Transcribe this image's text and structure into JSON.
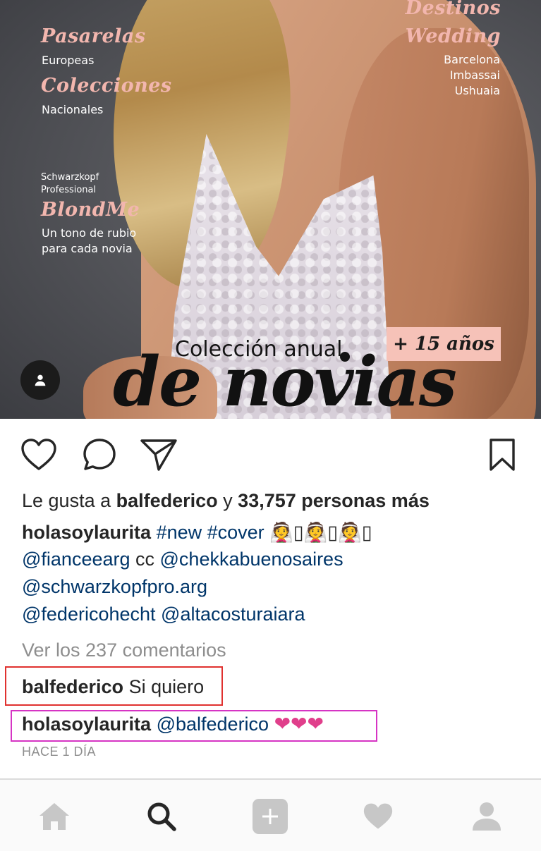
{
  "cover": {
    "pasarelas": "Pasarelas",
    "europeas": "Europeas",
    "colecciones": "Colecciones",
    "nacionales": "Nacionales",
    "schwarzkopf_line1": "Schwarzkopf",
    "schwarzkopf_line2": "Professional",
    "blondme": "BlondMe",
    "blondme_line1": "Un tono de rubio",
    "blondme_line2": "para cada novia",
    "destinos": "Destinos",
    "wedding": "Wedding",
    "cities": [
      "Barcelona",
      "Imbassai",
      "Ushuaia"
    ],
    "badge": "+ 15 años",
    "coleccion_anual": "Colección anual",
    "de_novias": "de novias"
  },
  "icons": {
    "tag_user": "user-tag-icon",
    "like": "heart-outline-icon",
    "comment": "comment-icon",
    "share": "send-icon",
    "save": "bookmark-icon"
  },
  "likes": {
    "prefix": "Le gusta a ",
    "user": "balfederico",
    "middle": " y ",
    "count_text": "33,757 personas más"
  },
  "caption": {
    "user": "holasoylaurita",
    "hashtags": "#new #cover",
    "emojis": "👰▯👰▯👰▯",
    "line2_mention1": "@fianceearg",
    "line2_cc": " cc ",
    "line2_mention2": "@chekkabuenosaires",
    "line3": "@schwarzkopfpro.arg",
    "line4_mention1": "@federicohecht",
    "line4_mention2": "@altacosturaiara"
  },
  "comments_link": "Ver los 237 comentarios",
  "comments": [
    {
      "user": "balfederico",
      "text": "Si quiero"
    },
    {
      "user": "holasoylaurita",
      "mention": "@balfederico",
      "hearts": "❤❤❤"
    }
  ],
  "timestamp": "HACE 1 DÍA",
  "nav": [
    "home-icon",
    "search-icon",
    "add-post-icon",
    "activity-heart-icon",
    "profile-icon"
  ],
  "colors": {
    "link": "#003569",
    "muted": "#8e8e8e",
    "highlight_red": "#e0312f",
    "highlight_pink": "#d634c4",
    "heart_pink": "#e03f8b"
  }
}
